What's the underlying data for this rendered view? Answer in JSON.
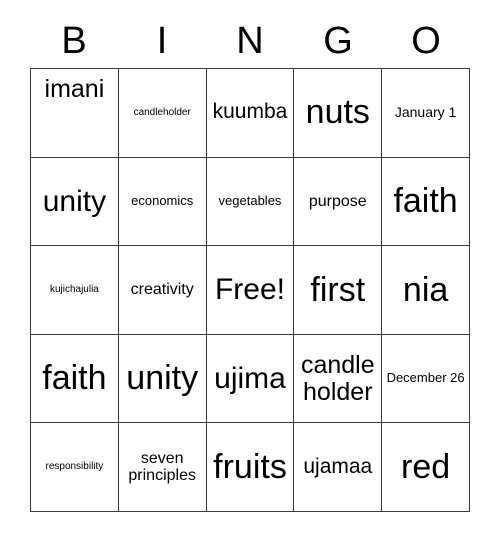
{
  "card": {
    "header_letters": [
      "B",
      "I",
      "N",
      "G",
      "O"
    ],
    "rows": [
      [
        {
          "text": "imani",
          "size": "fs-xl",
          "valign": "top"
        },
        {
          "text": "candleholder",
          "size": "fs-xs",
          "valign": "center"
        },
        {
          "text": "kuumba",
          "size": "fs-lg",
          "valign": "center"
        },
        {
          "text": "nuts",
          "size": "fs-3xl",
          "valign": "center"
        },
        {
          "text": "January 1",
          "size": "fs-smm",
          "valign": "center"
        }
      ],
      [
        {
          "text": "unity",
          "size": "fs-2xl",
          "valign": "center"
        },
        {
          "text": "economics",
          "size": "fs-sm",
          "valign": "center"
        },
        {
          "text": "vegetables",
          "size": "fs-sm",
          "valign": "center"
        },
        {
          "text": "purpose",
          "size": "fs-md",
          "valign": "center"
        },
        {
          "text": "faith",
          "size": "fs-3xl",
          "valign": "center"
        }
      ],
      [
        {
          "text": "kujichajulia",
          "size": "fs-xs",
          "valign": "center"
        },
        {
          "text": "creativity",
          "size": "fs-md",
          "valign": "center"
        },
        {
          "text": "Free!",
          "size": "fs-2xl",
          "valign": "center"
        },
        {
          "text": "first",
          "size": "fs-3xl",
          "valign": "center"
        },
        {
          "text": "nia",
          "size": "fs-3xl",
          "valign": "center"
        }
      ],
      [
        {
          "text": "faith",
          "size": "fs-3xl",
          "valign": "center"
        },
        {
          "text": "unity",
          "size": "fs-3xl",
          "valign": "center"
        },
        {
          "text": "ujima",
          "size": "fs-2xl",
          "valign": "center"
        },
        {
          "text": "candle holder",
          "size": "fs-xl",
          "valign": "center"
        },
        {
          "text": "December 26",
          "size": "fs-sm",
          "valign": "center"
        }
      ],
      [
        {
          "text": "responsibility",
          "size": "fs-xs",
          "valign": "center"
        },
        {
          "text": "seven principles",
          "size": "fs-md",
          "valign": "center"
        },
        {
          "text": "fruits",
          "size": "fs-3xl",
          "valign": "center"
        },
        {
          "text": "ujamaa",
          "size": "fs-lg",
          "valign": "center"
        },
        {
          "text": "red",
          "size": "fs-3xl",
          "valign": "center"
        }
      ]
    ]
  },
  "colors": {
    "background": "#ffffff",
    "text": "#000000",
    "border": "#3a3a3a"
  }
}
